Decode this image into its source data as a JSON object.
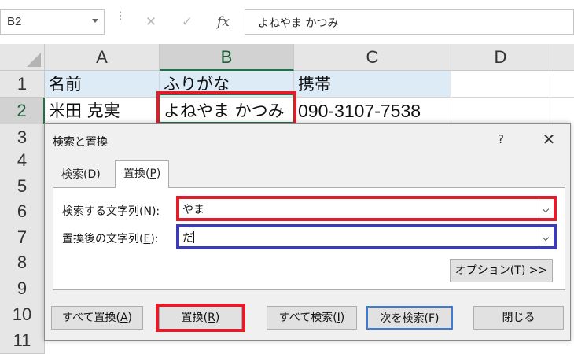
{
  "formula_bar": {
    "name_box": "B2",
    "dots": "⋮",
    "cancel_glyph": "✕",
    "enter_glyph": "✓",
    "fx_glyph": "fx",
    "content": "よねやま かつみ"
  },
  "sheet": {
    "columns": [
      "A",
      "B",
      "C",
      "D"
    ],
    "rows": [
      "1",
      "2",
      "3",
      "4",
      "5",
      "6",
      "7",
      "8",
      "9",
      "10",
      "11"
    ],
    "cells": {
      "a1": "名前",
      "b1": "ふりがな",
      "c1": "携帯",
      "a2": "米田 克実",
      "b2": "よねやま かつみ",
      "c2": "090-3107-7538"
    }
  },
  "dialog": {
    "title": "検索と置換",
    "help": "?",
    "close": "✕",
    "tabs": [
      {
        "label": "検索(",
        "key": "D",
        "end": ")"
      },
      {
        "label": "置換(",
        "key": "P",
        "end": ")"
      }
    ],
    "find_label": {
      "text": "検索する文字列(",
      "key": "N",
      "end": "):"
    },
    "find_value": "やま",
    "replace_label": {
      "text": "置換後の文字列(",
      "key": "E",
      "end": "):"
    },
    "replace_value": "だ",
    "options_button": {
      "text": "オプション(",
      "key": "T",
      "end": ") >>"
    },
    "buttons": {
      "replace_all": {
        "text": "すべて置換(",
        "key": "A",
        "end": ")"
      },
      "replace": {
        "text": "置換(",
        "key": "R",
        "end": ")"
      },
      "find_all": {
        "text": "すべて検索(",
        "key": "I",
        "end": ")"
      },
      "find_next": {
        "text": "次を検索(",
        "key": "F",
        "end": ")"
      },
      "close": "閉じる"
    }
  },
  "colors": {
    "highlight_red": "#e01e2b",
    "highlight_blue": "#3c3ab5",
    "header_fill": "#ddebf7",
    "excel_green": "#217346"
  }
}
